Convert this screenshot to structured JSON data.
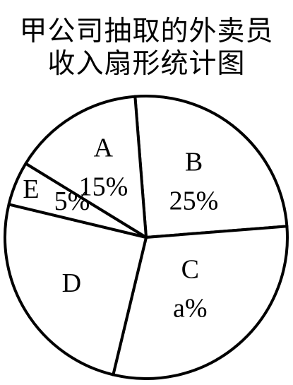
{
  "chart_data": {
    "type": "pie",
    "title_lines": [
      "甲公司抽取的外卖员",
      "收入扇形统计图"
    ],
    "slices": [
      {
        "name": "A",
        "value": 15,
        "value_label": "15%"
      },
      {
        "name": "B",
        "value": 25,
        "value_label": "25%"
      },
      {
        "name": "C",
        "value": 30,
        "value_label": "a%"
      },
      {
        "name": "D",
        "value": 25,
        "value_label": ""
      },
      {
        "name": "E",
        "value": 5,
        "value_label": "5%"
      }
    ],
    "colors": {
      "stroke": "#000000",
      "fill": "#ffffff",
      "text": "#000000"
    }
  }
}
